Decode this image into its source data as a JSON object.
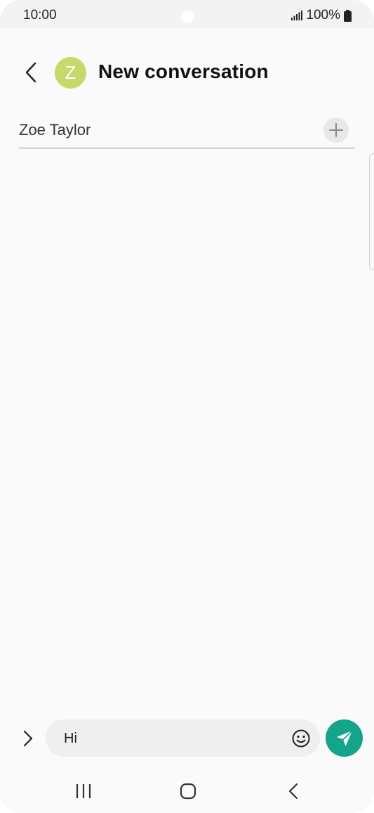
{
  "status_bar": {
    "time": "10:00",
    "battery": "100%",
    "icons": [
      "signal-icon",
      "battery-icon"
    ]
  },
  "header": {
    "avatar_letter": "Z",
    "title": "New conversation",
    "avatar_color": "#c8d86a",
    "icons": [
      "back-arrow-icon"
    ]
  },
  "recipient": {
    "name": "Zoe Taylor",
    "icons": [
      "plus-icon"
    ]
  },
  "composer": {
    "message_value": "Hi",
    "icons": [
      "chevron-right-icon",
      "emoji-icon",
      "send-icon"
    ],
    "send_color": "#14a38b"
  },
  "nav_bar": {
    "icons": [
      "recent-apps-icon",
      "home-icon",
      "back-icon"
    ]
  }
}
